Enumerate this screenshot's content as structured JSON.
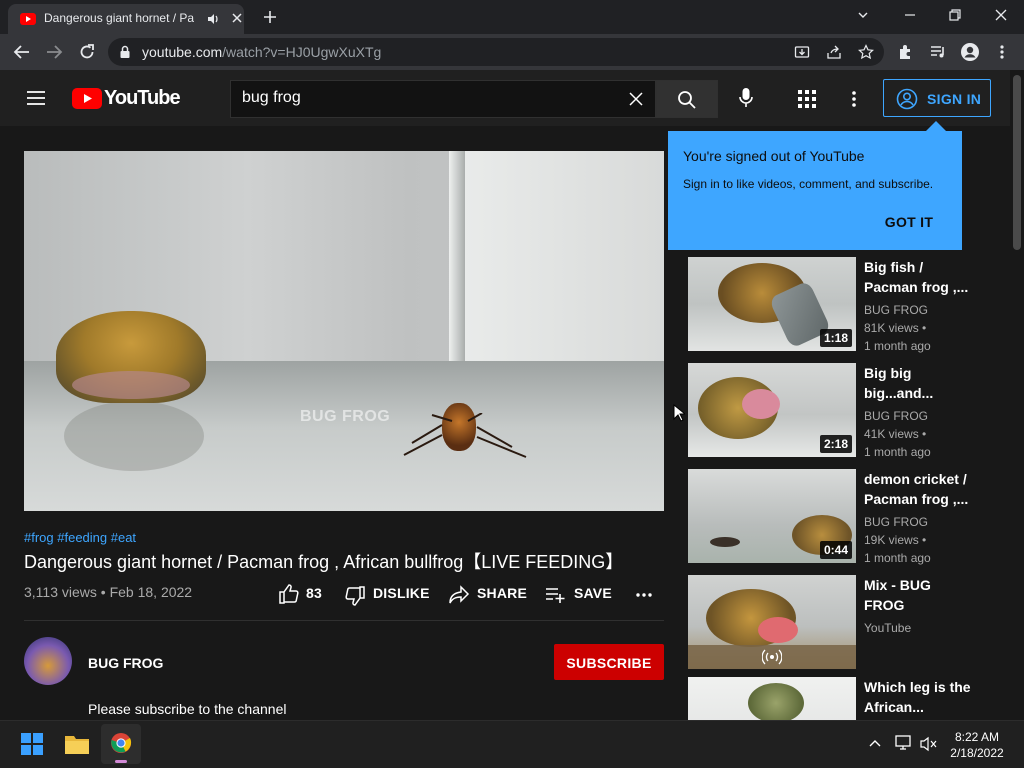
{
  "browser": {
    "tab_title": "Dangerous giant hornet / Pa",
    "url_host": "youtube.com",
    "url_path": "/watch?v=HJ0UgwXuXTg"
  },
  "youtube": {
    "logo_text": "YouTube",
    "search_value": "bug frog",
    "signin_label": "SIGN IN"
  },
  "popup": {
    "title": "You're signed out of YouTube",
    "subtitle": "Sign in to like videos, comment, and subscribe.",
    "button": "GOT IT"
  },
  "video": {
    "watermark": "BUG FROG",
    "hashtags": "#frog #feeding #eat",
    "title": "Dangerous giant hornet / Pacman frog , African bullfrog【LIVE FEEDING】",
    "meta": "3,113 views • Feb 18, 2022",
    "likes": "83",
    "dislike_label": "DISLIKE",
    "share_label": "SHARE",
    "save_label": "SAVE",
    "channel_name": "BUG FROG",
    "subscribe_label": "SUBSCRIBE",
    "description": "Please subscribe to the channel"
  },
  "recommendations": [
    {
      "title": "Big fish / Pacman frog ,...",
      "channel": "BUG FROG",
      "views": "81K views •",
      "age": "1 month ago",
      "duration": "1:18"
    },
    {
      "title": "Big big big...and...",
      "channel": "BUG FROG",
      "views": "41K views •",
      "age": "1 month ago",
      "duration": "2:18"
    },
    {
      "title": "demon cricket / Pacman frog ,...",
      "channel": "BUG FROG",
      "views": "19K views •",
      "age": "1 month ago",
      "duration": "0:44"
    },
    {
      "title": "Mix - BUG FROG",
      "channel": "YouTube"
    },
    {
      "title": "Which leg is the African..."
    }
  ],
  "taskbar": {
    "time": "8:22 AM",
    "date": "2/18/2022"
  },
  "colors": {
    "accent_blue": "#3ea6ff",
    "youtube_red": "#ff0000",
    "subscribe_red": "#cc0000",
    "background": "#181818"
  }
}
